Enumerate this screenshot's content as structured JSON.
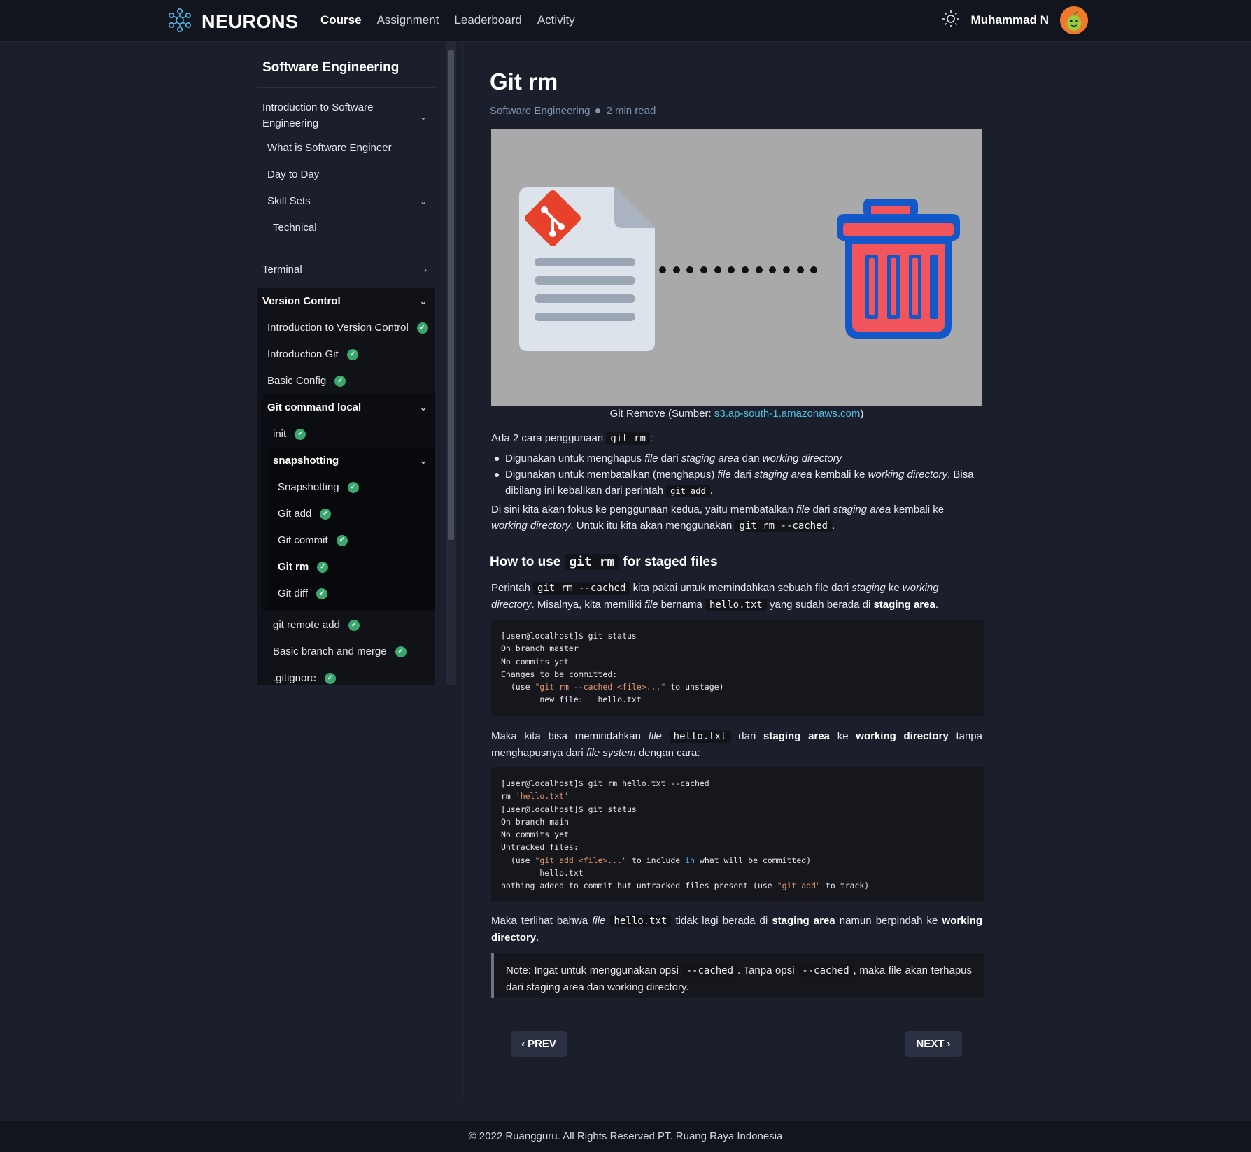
{
  "app": {
    "brand": "NEURONS"
  },
  "nav": [
    {
      "label": "Course",
      "active": true
    },
    {
      "label": "Assignment",
      "active": false
    },
    {
      "label": "Leaderboard",
      "active": false
    },
    {
      "label": "Activity",
      "active": false
    }
  ],
  "user": {
    "name": "Muhammad N"
  },
  "sidebar": {
    "title": "Software Engineering",
    "intro_section": "Introduction to Software Engineering",
    "intro_line1": "Introduction to Software",
    "intro_line2": "Engineering",
    "items": {
      "what_is": "What is Software Engineer",
      "day_to_day": "Day to Day",
      "skill_sets": "Skill Sets",
      "technical": "Technical",
      "terminal": "Terminal",
      "version_control": "Version Control",
      "intro_vc": "Introduction to Version Control",
      "intro_git": "Introduction Git",
      "basic_config": "Basic Config",
      "git_command_local": "Git command local",
      "init": "init",
      "snapshotting_group": "snapshotting",
      "snapshotting": "Snapshotting",
      "git_add": "Git add",
      "git_commit": "Git commit",
      "git_rm": "Git rm",
      "git_diff": "Git diff",
      "git_remote_add": "git remote add",
      "basic_branch": "Basic branch and merge",
      "gitignore": ".gitignore"
    }
  },
  "article": {
    "title": "Git rm",
    "category": "Software Engineering",
    "read_time": "2 min read",
    "caption_prefix": "Git Remove (Sumber: ",
    "caption_link": "s3.ap-south-1.amazonaws.com",
    "caption_suffix": ")",
    "p1_prefix": "Ada 2 cara penggunaan",
    "p1_code": "git rm",
    "p1_suffix": ":",
    "b1": {
      "a": "Digunakan untuk menghapus ",
      "i1": "file",
      "b": " dari ",
      "i2": "staging area",
      "c": " dan ",
      "i3": "working directory"
    },
    "b2": {
      "a": "Digunakan untuk membatalkan (menghapus) ",
      "i1": "file",
      "b": " dari ",
      "i2": "staging area",
      "c": " kembali ke ",
      "i3": "working directory",
      "d": ". Bisa dibilang ini kebalikan dari perintah",
      "code": "git add",
      "e": "."
    },
    "p2": {
      "a": "Di sini kita akan fokus ke penggunaan kedua, yaitu membatalkan ",
      "i1": "file",
      "b": " dari ",
      "i2": "staging area",
      "c": " kembali ke ",
      "i3": "working directory",
      "d": ". Untuk itu kita akan menggunakan",
      "code": "git rm --cached",
      "e": "."
    },
    "h2_prefix": "How to use",
    "h2_code": "git rm",
    "h2_suffix": "for staged files",
    "p3": {
      "a": "Perintah",
      "code1": "git rm --cached",
      "b": "kita pakai untuk memindahkan sebuah file dari ",
      "i1": "staging",
      "c": " ke ",
      "i2": "working directory",
      "d": ". Misalnya, kita memiliki ",
      "i3": "file",
      "e": " bernama",
      "code2": "hello.txt",
      "f": "yang sudah berada di ",
      "b1": "staging area",
      "g": "."
    },
    "code1": {
      "l1": "[user@localhost]$ git status",
      "l2": "On branch master",
      "l3": "No commits yet",
      "l4": "Changes to be committed:",
      "l5a": "  (use ",
      "l5s": "\"git rm --cached <file>...\"",
      "l5b": " to unstage)",
      "l6": "        new file:   hello.txt"
    },
    "p4": {
      "a": "Maka kita bisa memindahkan ",
      "i1": "file",
      "code": "hello.txt",
      "b": "dari ",
      "b1": "staging area",
      "c": " ke ",
      "b2": "working directory",
      "d": " tanpa menghapusnya dari ",
      "i2": "file system",
      "e": " dengan cara:"
    },
    "code2": {
      "l1": "[user@localhost]$ git rm hello.txt --cached",
      "l2a": "rm ",
      "l2s": "'hello.txt'",
      "l3": "[user@localhost]$ git status",
      "l4": "On branch main",
      "l5": "No commits yet",
      "l6": "Untracked files:",
      "l7a": "  (use ",
      "l7s": "\"git add <file>...\"",
      "l7b": " to include ",
      "l7k": "in",
      "l7c": " what will be committed)",
      "l8": "        hello.txt",
      "l9a": "nothing added to commit but untracked files present (use ",
      "l9s": "\"git add\"",
      "l9b": " to track)"
    },
    "p5": {
      "a": "Maka terlihat bahwa ",
      "i1": "file",
      "code": "hello.txt",
      "b": "tidak lagi berada di ",
      "b1": "staging area",
      "c": " namun berpindah ke ",
      "b2": "working directory",
      "d": "."
    },
    "note": {
      "a": "Note: Ingat untuk menggunakan opsi",
      "code1": "--cached",
      "b": ". Tanpa opsi",
      "code2": "--cached",
      "c": ", maka file akan terhapus dari staging area dan working directory."
    }
  },
  "pagination": {
    "prev": "PREV",
    "next": "NEXT"
  },
  "footer": "© 2022 Ruangguru. All Rights Reserved PT. Ruang Raya Indonesia",
  "colors": {
    "background": "#1b1f2c",
    "topbar": "#12151d",
    "check": "#3aa76d",
    "link": "#4fc0e0",
    "meta": "#7e93ae"
  }
}
